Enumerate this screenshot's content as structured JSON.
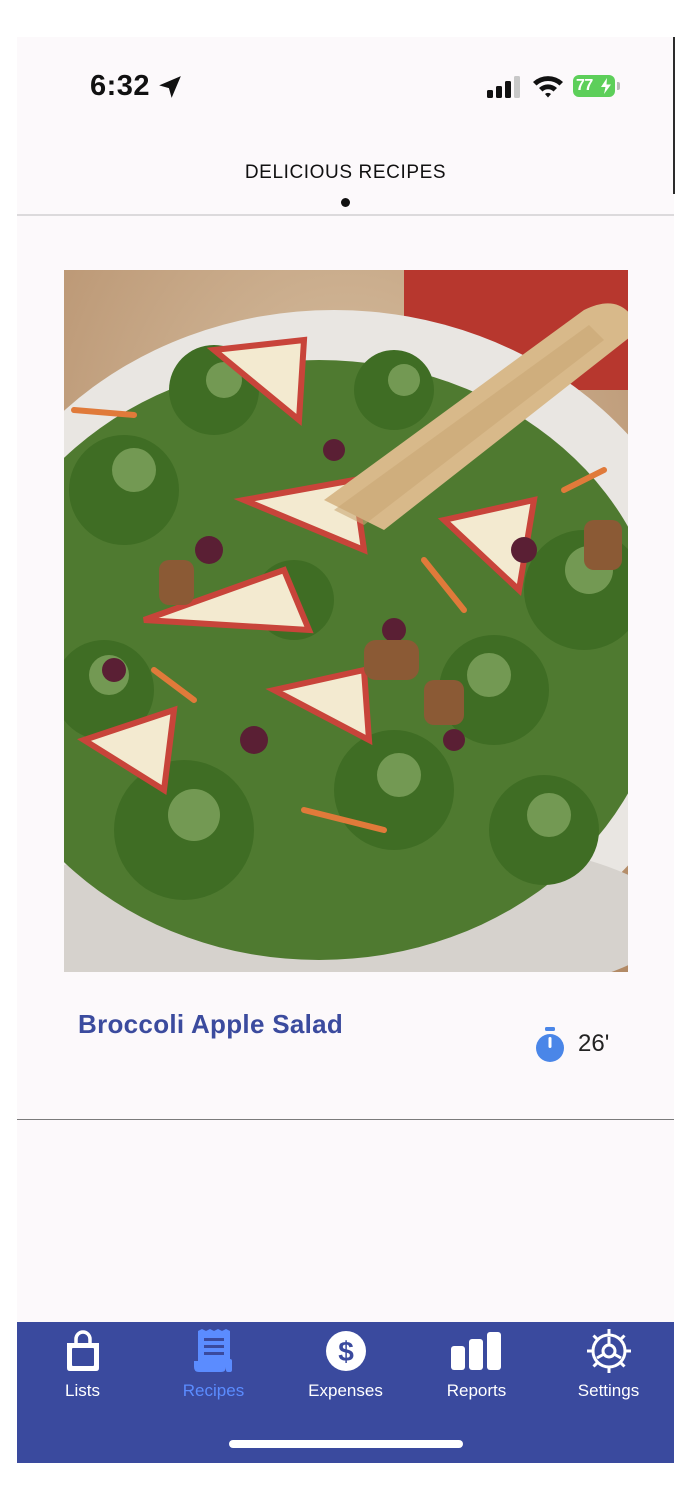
{
  "status_bar": {
    "time": "6:32",
    "battery": "77"
  },
  "header": {
    "title": "DELICIOUS RECIPES"
  },
  "recipe": {
    "name": "Broccoli Apple Salad",
    "time": "26'"
  },
  "tabs": [
    {
      "label": "Lists",
      "icon": "shopping-bag-icon",
      "active": false
    },
    {
      "label": "Recipes",
      "icon": "receipt-icon",
      "active": true
    },
    {
      "label": "Expenses",
      "icon": "dollar-icon",
      "active": false
    },
    {
      "label": "Reports",
      "icon": "bar-chart-icon",
      "active": false
    },
    {
      "label": "Settings",
      "icon": "gear-icon",
      "active": false
    }
  ],
  "colors": {
    "accent": "#3a4a9e",
    "active_tab": "#5b8cff",
    "recipe_title": "#3b4b9e",
    "timer": "#4a86e8"
  }
}
